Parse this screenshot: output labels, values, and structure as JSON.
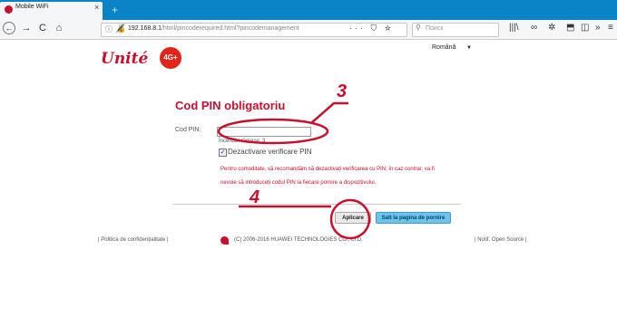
{
  "browser": {
    "tab_title": "Mobile WiFi",
    "tab_close": "×",
    "new_tab": "+",
    "back": "←",
    "forward": "→",
    "reload": "C",
    "home": "⌂",
    "info_glyph": "ⓘ",
    "lock_glyph": "🔏",
    "url_host": "192.168.8.1",
    "url_path": "/html/pincoderequired.html?pincodemanagement",
    "url_actions": "··· ⛉ ☆",
    "search_placeholder": "Поиск",
    "tools": [
      "|||\\",
      "∞",
      "✲",
      "⬒",
      "◫",
      "»",
      "≡"
    ]
  },
  "page": {
    "logo_text": "Unité",
    "logo_badge": "4G+",
    "language": "Română",
    "language_caret": "▼",
    "title": "Cod PIN obligatoriu",
    "pin_label": "Cod PIN:",
    "attempts_text": "Încercări rămase:  3",
    "checkbox_checked": "✓",
    "checkbox_label": "Dezactivare verificare PIN",
    "note_line1": "Pentru comoditate, vă recomandăm să dezactivați verificarea cu PIN; în caz contrar, va fi",
    "note_line2": "nevoie să introduceți codul PIN la fiecare pornire a dispozitivului.",
    "apply_button": "Aplicare",
    "home_button": "Salt la pagina de pornire",
    "footer_left": "| Politica de confidențialitate |",
    "footer_center": "(C) 2006-2016 HUAWEI TECHNOLOGIES CO., LTD.",
    "footer_right": "| Notif. Open Source |"
  },
  "annotations": {
    "step3": "3",
    "step4": "4",
    "color": "#c8102e"
  }
}
